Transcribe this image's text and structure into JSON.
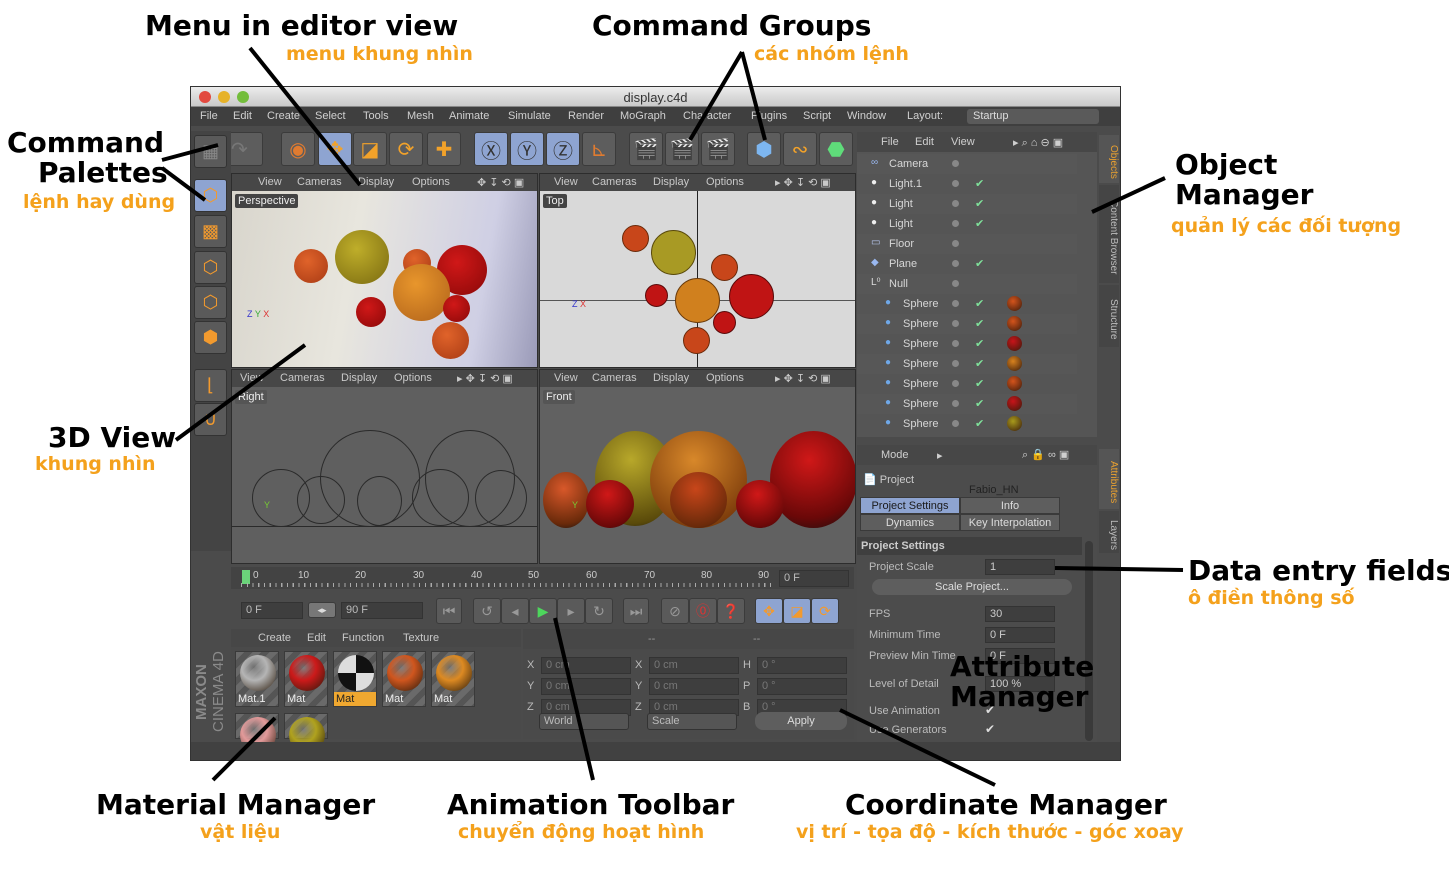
{
  "annotations": {
    "menu_editor": {
      "title": "Menu in editor view",
      "sub": "menu khung nhìn"
    },
    "command_groups": {
      "title": "Command Groups",
      "sub": "các nhóm lệnh"
    },
    "command_palettes": {
      "title_line1": "Command",
      "title_line2": "Palettes",
      "sub": "lệnh hay dùng"
    },
    "object_manager": {
      "title_line1": "Object",
      "title_line2": "Manager",
      "sub": "quản lý các đối tượng"
    },
    "view3d": {
      "title": "3D View",
      "sub": "khung nhìn"
    },
    "data_entry": {
      "title": "Data entry fields",
      "sub": "ô điền thông số"
    },
    "attribute_manager": {
      "title_line1": "Attribute",
      "title_line2": "Manager"
    },
    "material_manager": {
      "title": "Material Manager",
      "sub": "vật liệu"
    },
    "animation_toolbar": {
      "title": "Animation Toolbar",
      "sub": "chuyển động hoạt hình"
    },
    "coordinate_manager": {
      "title": "Coordinate Manager",
      "sub": "vị trí - tọa độ - kích thước - góc xoay"
    }
  },
  "window": {
    "title": "display.c4d",
    "menu": [
      "File",
      "Edit",
      "Create",
      "Select",
      "Tools",
      "Mesh",
      "Animate",
      "Simulate",
      "Render",
      "MoGraph",
      "Character",
      "Plugins",
      "Script",
      "Window"
    ],
    "layout_label": "Layout:",
    "layout_value": "Startup"
  },
  "viewport_menu": [
    "View",
    "Cameras",
    "Display",
    "Options"
  ],
  "viewports": [
    {
      "label": "Perspective"
    },
    {
      "label": "Top"
    },
    {
      "label": "Right"
    },
    {
      "label": "Front"
    }
  ],
  "object_manager": {
    "menu": [
      "File",
      "Edit",
      "View"
    ],
    "objects": [
      {
        "name": "Camera",
        "icon": "camera-icon",
        "check": false,
        "tex": null
      },
      {
        "name": "Light.1",
        "icon": "light-icon",
        "check": true,
        "tex": null
      },
      {
        "name": "Light",
        "icon": "light-icon",
        "check": true,
        "tex": null
      },
      {
        "name": "Light",
        "icon": "light-icon",
        "check": true,
        "tex": null
      },
      {
        "name": "Floor",
        "icon": "floor-icon",
        "check": false,
        "tex": null
      },
      {
        "name": "Plane",
        "icon": "plane-icon",
        "check": true,
        "tex": null
      },
      {
        "name": "Null",
        "icon": "null-icon",
        "check": false,
        "tex": null
      },
      {
        "name": "Sphere",
        "icon": "sphere-icon",
        "check": true,
        "tex": "#d4541c"
      },
      {
        "name": "Sphere",
        "icon": "sphere-icon",
        "check": true,
        "tex": "#d4541c"
      },
      {
        "name": "Sphere",
        "icon": "sphere-icon",
        "check": true,
        "tex": "#c8141a"
      },
      {
        "name": "Sphere",
        "icon": "sphere-icon",
        "check": true,
        "tex": "#d8821e"
      },
      {
        "name": "Sphere",
        "icon": "sphere-icon",
        "check": true,
        "tex": "#d4541c"
      },
      {
        "name": "Sphere",
        "icon": "sphere-icon",
        "check": true,
        "tex": "#c8141a"
      },
      {
        "name": "Sphere",
        "icon": "sphere-icon",
        "check": true,
        "tex": "#a89a1c"
      }
    ],
    "side_tabs": [
      "Objects",
      "Content Browser",
      "Structure"
    ]
  },
  "attribute_manager": {
    "mode": "Mode",
    "object": "Project",
    "user": "Fabio_HN",
    "tabs": [
      "Project Settings",
      "Info",
      "Dynamics",
      "Key Interpolation"
    ],
    "section": "Project Settings",
    "project_scale_label": "Project Scale",
    "project_scale": "1",
    "scale_button": "Scale Project...",
    "fields": [
      {
        "label": "FPS",
        "value": "30"
      },
      {
        "label": "Minimum Time",
        "value": "0 F"
      },
      {
        "label": "Preview Min Time",
        "value": "0 F"
      },
      {
        "label": "Level of Detail",
        "value": "100 %"
      }
    ],
    "checks": [
      {
        "label": "Use Animation",
        "checked": true
      },
      {
        "label": "Use Generators",
        "checked": true
      }
    ],
    "side_tabs": [
      "Attributes",
      "Layers"
    ]
  },
  "timeline": {
    "ticks": [
      "0",
      "10",
      "20",
      "30",
      "40",
      "50",
      "60",
      "70",
      "80",
      "90"
    ],
    "current": "0 F",
    "start": "0 F",
    "end": "90 F"
  },
  "material_manager": {
    "menu": [
      "Create",
      "Edit",
      "Function",
      "Texture"
    ],
    "materials": [
      {
        "name": "Mat.1",
        "color": "#b5b5b5",
        "selected": false
      },
      {
        "name": "Mat",
        "color": "#cc1a1a",
        "selected": false
      },
      {
        "name": "Mat",
        "color": "checker",
        "selected": true
      },
      {
        "name": "Mat",
        "color": "#d0561e",
        "selected": false
      },
      {
        "name": "Mat",
        "color": "#dd8a22",
        "selected": false
      },
      {
        "name": "",
        "color": "#e39a9a",
        "selected": false
      },
      {
        "name": "",
        "color": "#b0a21e",
        "selected": false
      }
    ],
    "brand1": "MAXON",
    "brand2": "CINEMA 4D"
  },
  "coordinate_manager": {
    "header": [
      "--",
      "--"
    ],
    "position": [
      {
        "axis": "X",
        "value": "0 cm"
      },
      {
        "axis": "Y",
        "value": "0 cm"
      },
      {
        "axis": "Z",
        "value": "0 cm"
      }
    ],
    "size": [
      {
        "axis": "X",
        "value": "0 cm"
      },
      {
        "axis": "Y",
        "value": "0 cm"
      },
      {
        "axis": "Z",
        "value": "0 cm"
      }
    ],
    "rotation": [
      {
        "axis": "H",
        "value": "0 °"
      },
      {
        "axis": "P",
        "value": "0 °"
      },
      {
        "axis": "B",
        "value": "0 °"
      }
    ],
    "mode1": "World",
    "mode2": "Scale",
    "apply": "Apply"
  }
}
